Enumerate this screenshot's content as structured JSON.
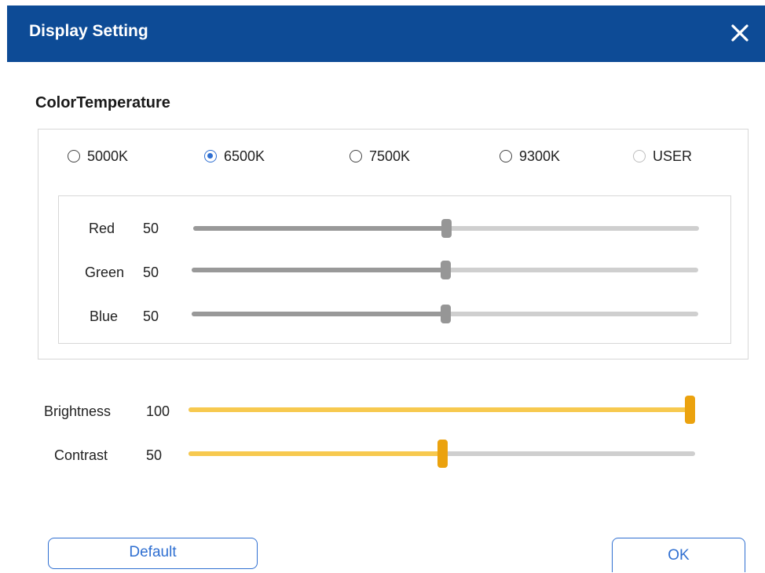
{
  "window": {
    "title": "Display Setting"
  },
  "color_temperature": {
    "label": "ColorTemperature",
    "options": [
      {
        "label": "5000K",
        "checked": false,
        "enabled": true
      },
      {
        "label": "6500K",
        "checked": true,
        "enabled": true
      },
      {
        "label": "7500K",
        "checked": false,
        "enabled": true
      },
      {
        "label": "9300K",
        "checked": false,
        "enabled": true
      },
      {
        "label": "USER",
        "checked": false,
        "enabled": false
      }
    ],
    "rgb": [
      {
        "name": "Red",
        "value": "50",
        "level": 0.5
      },
      {
        "name": "Green",
        "value": "50",
        "level": 0.5
      },
      {
        "name": "Blue",
        "value": "50",
        "level": 0.5
      }
    ]
  },
  "brightness": {
    "name": "Brightness",
    "value": "100",
    "level": 1.0
  },
  "contrast": {
    "name": "Contrast",
    "value": "50",
    "level": 0.5
  },
  "buttons": {
    "default_label": "Default",
    "ok_label": "OK"
  },
  "colors": {
    "titlebar": "#0d4b96",
    "accent": "#2f6fd1",
    "slider_gray": "#999999",
    "slider_gold": "#f7c94f",
    "thumb_gold": "#eba20e"
  },
  "icons": {
    "close": "close-icon"
  }
}
